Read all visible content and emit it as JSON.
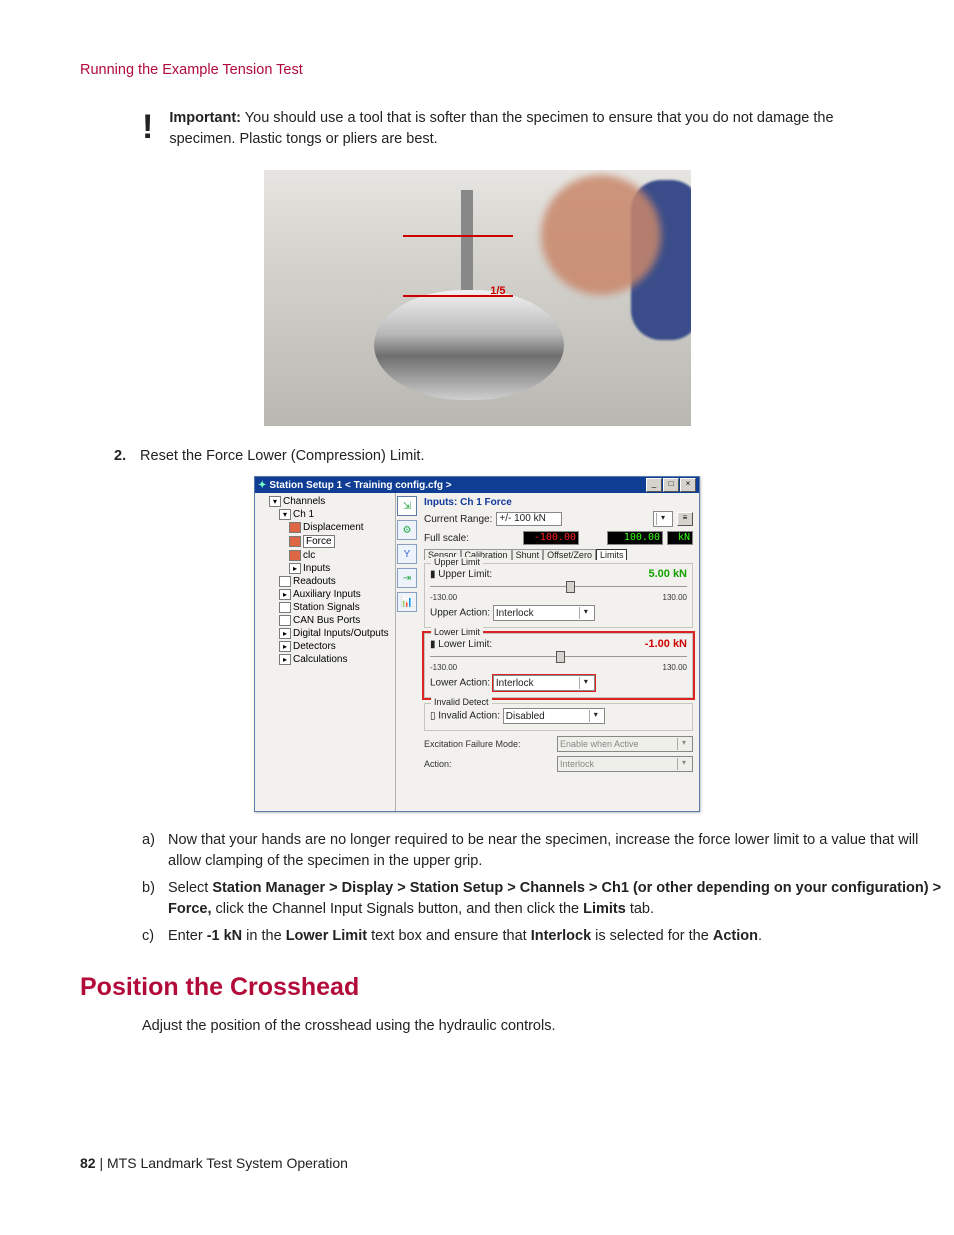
{
  "header": {
    "section": "Running the Example Tension Test"
  },
  "important": {
    "label": "Important:",
    "text": "You should use a tool that is softer than the specimen to ensure that you do not damage the specimen. Plastic tongs or pliers are best."
  },
  "photo": {
    "dim_label": "1/5"
  },
  "step2": {
    "number": "2.",
    "text": "Reset the Force Lower (Compression) Limit."
  },
  "win": {
    "title": "Station Setup 1 < Training config.cfg >",
    "ctrl_min": "_",
    "ctrl_max": "□",
    "ctrl_close": "×",
    "tree": {
      "root": "Channels",
      "ch1": "Ch 1",
      "disp": "Displacement",
      "force": "Force",
      "clc": "clc",
      "inputs": "Inputs",
      "readouts": "Readouts",
      "aux": "Auxiliary Inputs",
      "ssig": "Station Signals",
      "can": "CAN Bus Ports",
      "dio": "Digital Inputs/Outputs",
      "det": "Detectors",
      "calc": "Calculations"
    },
    "panel": {
      "title": "Inputs: Ch 1 Force",
      "cr_label": "Current Range:",
      "cr_value": "+/- 100 kN",
      "fs_label": "Full scale:",
      "fs_neg": "-100.00",
      "fs_pos": "100.00",
      "fs_unit": "kN",
      "tabs": [
        "Sensor",
        "Calibration",
        "Shunt",
        "Offset/Zero",
        "Limits"
      ],
      "tab_active": "Limits",
      "upper": {
        "group": "Upper Limit",
        "label": "Upper Limit:",
        "value": "5.00",
        "unit": "kN",
        "min": "-130.00",
        "max": "130.00",
        "action_label": "Upper Action:",
        "action_value": "Interlock"
      },
      "lower": {
        "group": "Lower Limit",
        "label": "Lower Limit:",
        "value": "-1.00",
        "unit": "kN",
        "min": "-130.00",
        "max": "130.00",
        "action_label": "Lower Action:",
        "action_value": "Interlock"
      },
      "invalid": {
        "group": "Invalid Detect",
        "label": "Invalid Action:",
        "value": "Disabled"
      },
      "efm_label": "Excitation Failure Mode:",
      "efm_value": "Enable when Active",
      "action_label": "Action:",
      "action_value": "Interlock"
    }
  },
  "sub": {
    "a_lt": "a)",
    "a": "Now that your hands are no longer required to be near the specimen, increase the force lower limit to a value that will allow clamping of the specimen in the upper grip.",
    "b_lt": "b)",
    "b_pre": "Select ",
    "b_bold1": "Station Manager > Display > Station Setup > Channels > Ch1 (or other depending on your configuration) > Force,",
    "b_mid": " click the Channel Input Signals button, and then click the ",
    "b_bold2": "Limits",
    "b_post": " tab.",
    "c_lt": "c)",
    "c_pre": "Enter ",
    "c_bold1": "-1 kN",
    "c_mid1": " in the ",
    "c_bold2": "Lower Limit",
    "c_mid2": " text box and ensure that ",
    "c_bold3": "Interlock",
    "c_mid3": " is selected for the ",
    "c_bold4": "Action",
    "c_end": "."
  },
  "h2": "Position the Crosshead",
  "crosshead": "Adjust the position of the crosshead using the hydraulic controls.",
  "footer": {
    "page": "82",
    "sep": " | ",
    "title": "MTS Landmark Test System Operation"
  }
}
